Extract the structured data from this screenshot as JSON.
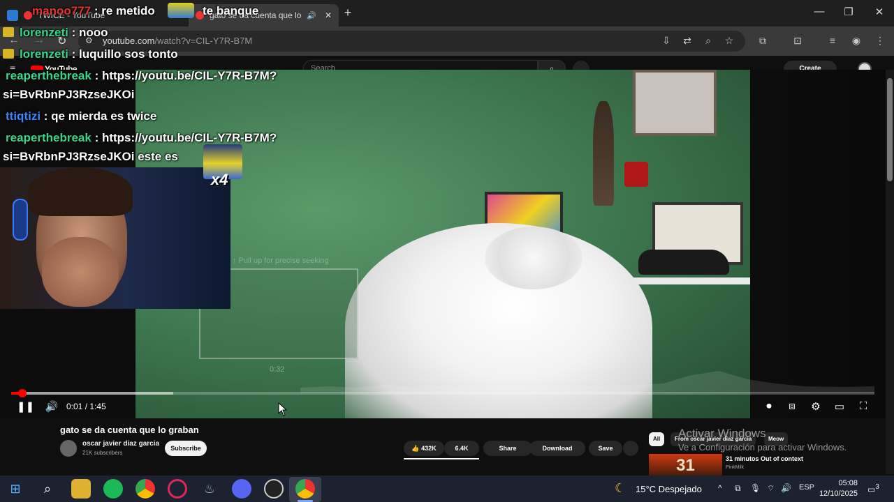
{
  "browser": {
    "tabs": [
      {
        "title": "TWICE - YouTube",
        "active": false
      },
      {
        "title": "gato se da cuenta que lo gr",
        "active": true
      }
    ],
    "new_tab": "+",
    "url_host": "youtube.com",
    "url_path": "/watch?v=CIL-Y7R-B7M",
    "window": {
      "minimize": "—",
      "restore": "❐",
      "close": "✕"
    }
  },
  "youtube": {
    "logo": "YouTube",
    "search_placeholder": "Search",
    "create_label": "Create"
  },
  "player": {
    "preview_hint": "↑ Pull up for precise seeking",
    "preview_time": "0:32",
    "current_time": "0:01",
    "duration": "1:45",
    "time_separator": "/",
    "progress_fraction": 0.0095
  },
  "chat": [
    {
      "user": "manoo777",
      "message": "re metido",
      "user_color": "red",
      "crown": false
    },
    {
      "user": "",
      "message": "te banque",
      "user_color": "green",
      "crown": false
    },
    {
      "user": "lorenzeti",
      "message": "nooo",
      "user_color": "green",
      "crown": true
    },
    {
      "user": "lorenzeti",
      "message": "luquillo sos tonto",
      "user_color": "green",
      "crown": true
    },
    {
      "user": "reaperthebreak",
      "message": "https://youtu.be/CIL-Y7R-B7M?",
      "user_color": "green",
      "crown": false
    },
    {
      "user": "",
      "message": "si=BvRbnPJ3RzseJKOi",
      "user_color": "green",
      "crown": false
    },
    {
      "user": "ttiqtizi",
      "message": "qe mierda es twice",
      "user_color": "blue",
      "crown": false
    },
    {
      "user": "reaperthebreak",
      "message": "https://youtu.be/CIL-Y7R-B7M?",
      "user_color": "green",
      "crown": false
    },
    {
      "user": "",
      "message": "si=BvRbnPJ3RzseJKOi este es",
      "user_color": "green",
      "crown": false
    }
  ],
  "emote_multiplier": "x4",
  "video_info": {
    "title": "gato se da cuenta que lo graban",
    "channel": "oscar javier diaz garcia",
    "subscribers": "21K subscribers",
    "subscribe_label": "Subscribe",
    "likes": "432K",
    "dislikes": "6.4K",
    "share_label": "Share",
    "download_label": "Download",
    "save_label": "Save"
  },
  "sidebar": {
    "chips": [
      "All",
      "From oscar javier diaz garcia",
      "Meow"
    ],
    "rec_title": "31 minutos Out of context",
    "rec_channel": "PinkMilk",
    "rec_thumb_text": "31"
  },
  "windows_activation": {
    "title": "Activar Windows",
    "subtitle": "Ve a Configuración para activar Windows."
  },
  "taskbar": {
    "weather": "15°C  Despejado",
    "language": "ESP",
    "time": "05:08",
    "date": "12/10/2025",
    "notifications": "3"
  },
  "colors": {
    "accent_red": "#ff0000",
    "chat_green": "#35d88a",
    "chat_blue": "#3a88ff"
  }
}
